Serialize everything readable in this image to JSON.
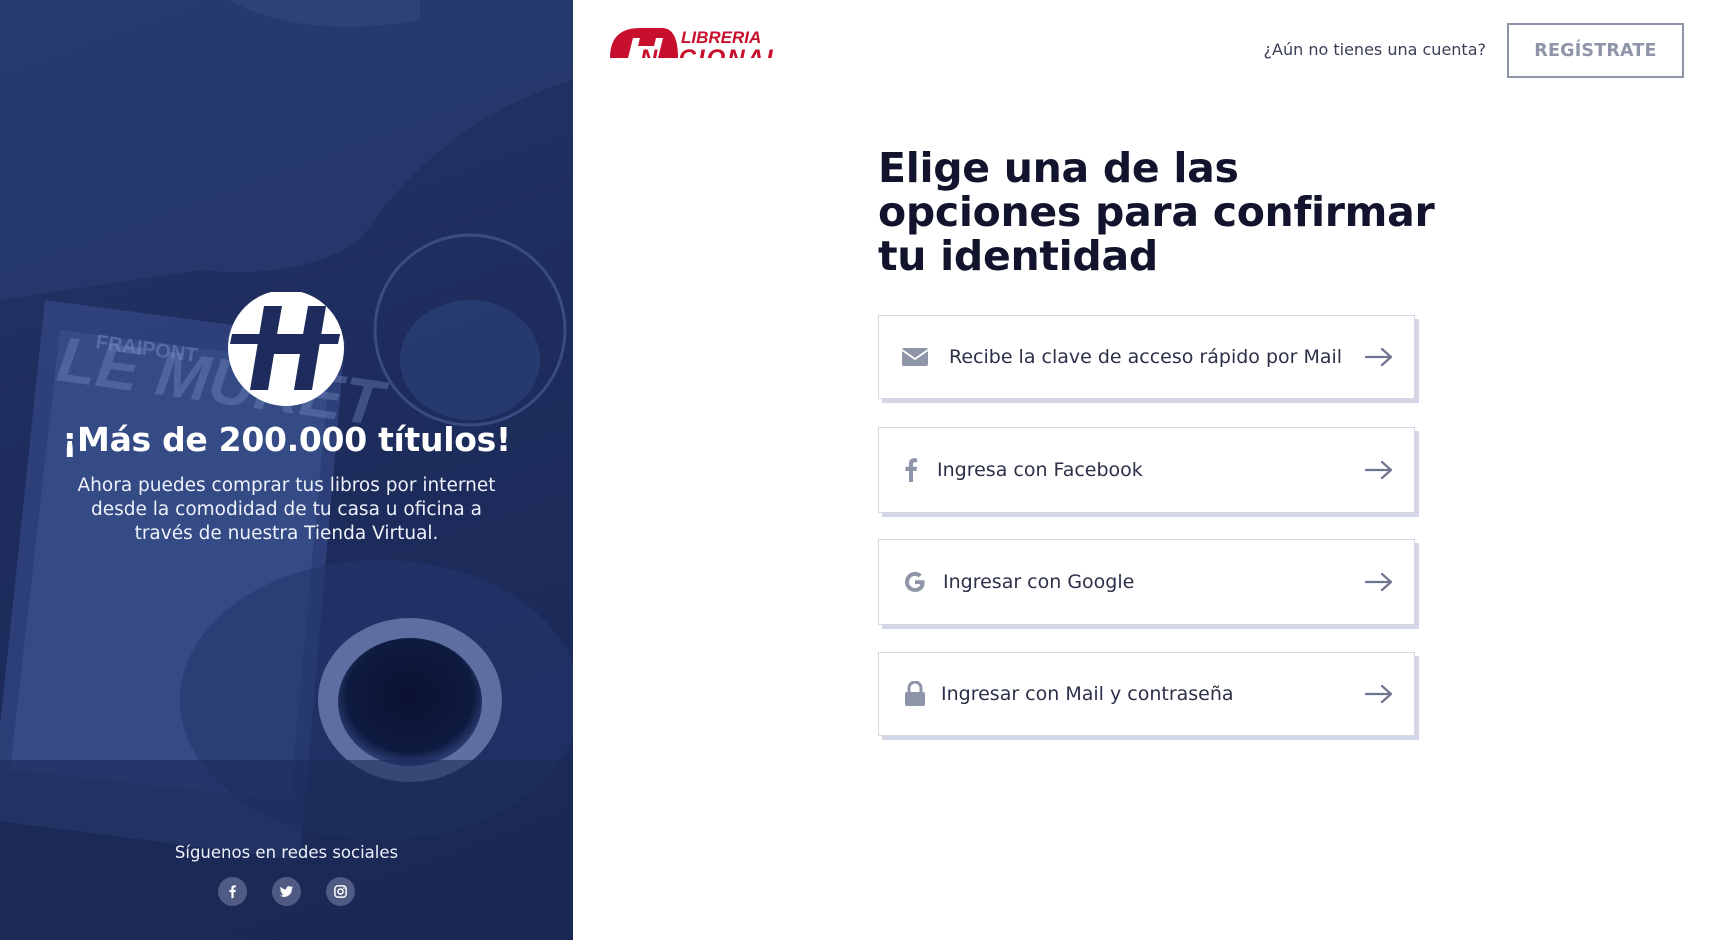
{
  "colors": {
    "panel_bg": "#1d2c5c",
    "brand_red": "#c8102e",
    "title_text": "#12132c",
    "icon_gray": "#8f95a8"
  },
  "logo": {
    "text_top": "LIBRERIA",
    "text_bottom": "NACIONAL"
  },
  "left_panel": {
    "headline": "¡Más de 200.000 títulos!",
    "subtext": "Ahora puedes comprar tus libros por internet desde la comodidad de tu casa u oficina a través de nuestra Tienda Virtual.",
    "background_words": "LE MURET",
    "background_small": "FRAIPONT",
    "social_title": "Síguenos en redes sociales",
    "social": [
      {
        "icon": "facebook-icon"
      },
      {
        "icon": "twitter-icon"
      },
      {
        "icon": "instagram-icon"
      }
    ]
  },
  "header": {
    "prompt": "¿Aún no tienes una cuenta?",
    "register_label": "REGÍSTRATE"
  },
  "main": {
    "title": "Elige una de las opciones para confirmar tu identidad",
    "options": [
      {
        "icon": "mail-icon",
        "label": "Recibe la clave de acceso rápido por Mail"
      },
      {
        "icon": "facebook-icon",
        "label": "Ingresa con Facebook"
      },
      {
        "icon": "google-icon",
        "label": "Ingresar con Google"
      },
      {
        "icon": "lock-icon",
        "label": "Ingresar con Mail y contraseña"
      }
    ]
  }
}
